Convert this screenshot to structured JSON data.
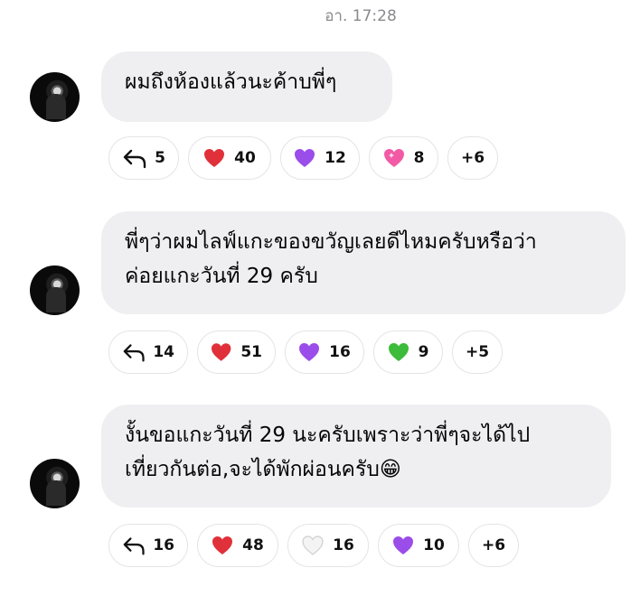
{
  "timestamp": "อา. 17:28",
  "messages": [
    {
      "text": "ผมถึงห้องแล้วนะค้าบพี่ๆ",
      "reactions": {
        "reply": "5",
        "red": "40",
        "purple": "12",
        "pink": "8",
        "more": "+6"
      }
    },
    {
      "line1": "พี่ๆว่าผมไลฟ์แกะของขวัญเลยดีไหมครับหรือว่า",
      "line2": "ค่อยแกะวันที่ 29 ครับ",
      "reactions": {
        "reply": "14",
        "red": "51",
        "purple": "16",
        "green": "9",
        "more": "+5"
      }
    },
    {
      "line1": "งั้นขอแกะวันที่ 29 นะครับเพราะว่าพี่ๆจะได้ไป",
      "line2": "เที่ยวกันต่อ,จะได้พักผ่อนครับ😁",
      "reactions": {
        "reply": "16",
        "red": "48",
        "white": "16",
        "purple": "10",
        "more": "+6"
      }
    }
  ],
  "colors": {
    "red_heart": "#e0313a",
    "purple_heart": "#9b4dea",
    "pink_heart": "#f25aa5",
    "green_heart": "#3dbb3a",
    "white_heart": "#f0f0f0"
  },
  "icons": [
    "reply-icon",
    "red-heart-icon",
    "purple-heart-icon",
    "pink-heart-icon",
    "green-heart-icon",
    "white-heart-icon"
  ]
}
